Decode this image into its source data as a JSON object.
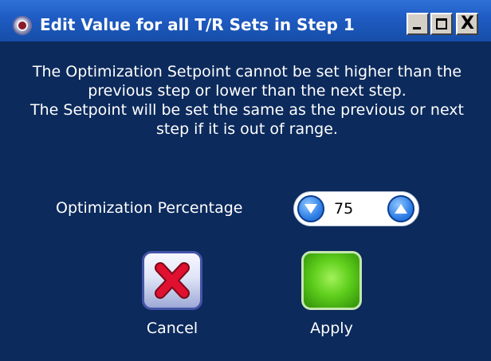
{
  "window": {
    "title": "Edit Value for all T/R Sets in Step 1",
    "close_glyph": "X"
  },
  "message": {
    "lines": [
      "The Optimization Setpoint cannot be set higher than the previous step or lower than the next step.",
      "The Setpoint will be set the same as the previous or next step if it is out of range."
    ]
  },
  "optimization": {
    "label": "Optimization Percentage",
    "value": "75"
  },
  "actions": {
    "cancel_label": "Cancel",
    "apply_label": "Apply"
  },
  "colors": {
    "background": "#0c2a5c",
    "titlebar": "#1f5cc4",
    "text": "#ffffff",
    "apply_green": "#5fcf1c",
    "cancel_red": "#e01030"
  },
  "icons": {
    "app": "app-icon",
    "minimize": "minimize-icon",
    "maximize": "maximize-icon",
    "close": "close-icon",
    "decrement": "chevron-down-icon",
    "increment": "chevron-up-icon",
    "cancel": "red-x-icon"
  }
}
